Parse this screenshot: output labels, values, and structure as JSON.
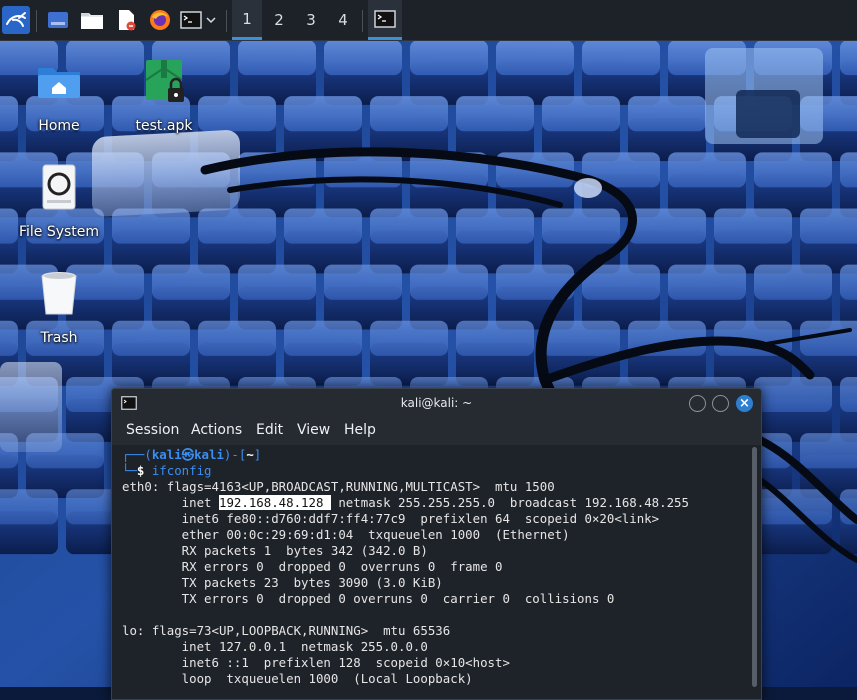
{
  "panel": {
    "workspaces": [
      "1",
      "2",
      "3",
      "4"
    ],
    "active_workspace": "1"
  },
  "desktop": {
    "icons": [
      {
        "label": "Home"
      },
      {
        "label": "test.apk"
      },
      {
        "label": "File System"
      },
      {
        "label": "Trash"
      }
    ]
  },
  "terminal": {
    "title": "kali@kali: ~",
    "menu": [
      "Session",
      "Actions",
      "Edit",
      "View",
      "Help"
    ],
    "prompt": {
      "open": "┌──(",
      "user": "kali㉿kali",
      "close": ")-[",
      "dir": "~",
      "end": "]",
      "line2": "└─",
      "dollar": "$ ",
      "command": "ifconfig"
    },
    "eth0": {
      "l1": "eth0: flags=4163<UP,BROADCAST,RUNNING,MULTICAST>  mtu 1500",
      "inet_pre": "        inet ",
      "inet_ip": "192.168.48.128 ",
      "inet_post": " netmask 255.255.255.0  broadcast 192.168.48.255",
      "l3": "        inet6 fe80::d760:ddf7:ff4:77c9  prefixlen 64  scopeid 0×20<link>",
      "l4": "        ether 00:0c:29:69:d1:04  txqueuelen 1000  (Ethernet)",
      "l5": "        RX packets 1  bytes 342 (342.0 B)",
      "l6": "        RX errors 0  dropped 0  overruns 0  frame 0",
      "l7": "        TX packets 23  bytes 3090 (3.0 KiB)",
      "l8": "        TX errors 0  dropped 0 overruns 0  carrier 0  collisions 0"
    },
    "lo": {
      "l1": "lo: flags=73<UP,LOOPBACK,RUNNING>  mtu 65536",
      "l2": "        inet 127.0.0.1  netmask 255.0.0.0",
      "l3": "        inet6 ::1  prefixlen 128  scopeid 0×10<host>",
      "l4": "        loop  txqueuelen 1000  (Local Loopback)"
    }
  },
  "colors": {
    "accent": "#3d8fd6",
    "prompt": "#3a8ef0",
    "panel_bg": "#1d2128",
    "terminal_bg": "#1e2229"
  }
}
